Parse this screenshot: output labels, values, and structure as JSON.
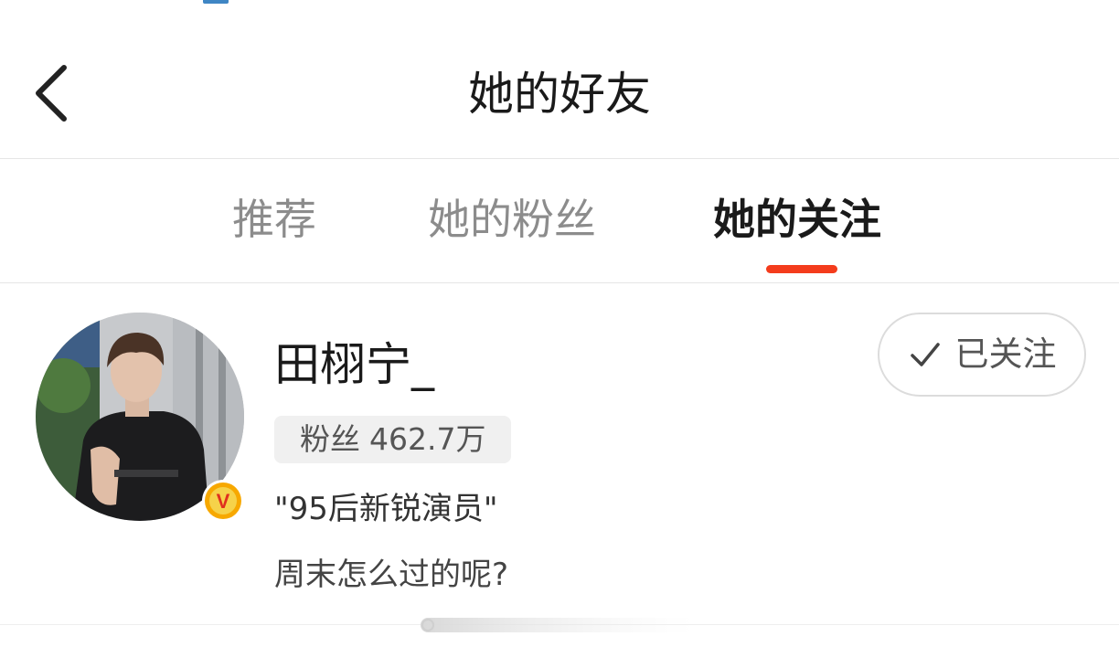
{
  "header": {
    "title": "她的好友",
    "back_icon": "chevron-left-icon"
  },
  "tabs": [
    {
      "label": "推荐",
      "active": false
    },
    {
      "label": "她的粉丝",
      "active": false
    },
    {
      "label": "她的关注",
      "active": true
    }
  ],
  "colors": {
    "accent": "#f43c1c",
    "verified_badge": "#f7a800",
    "text_primary": "#1a1a1a",
    "text_muted": "#8c8c8c"
  },
  "users": [
    {
      "name": "田栩宁_",
      "fans_label": "粉丝",
      "fans_count": "462.7万",
      "bio": "\"95后新锐演员\"",
      "recent_post": "周末怎么过的呢?",
      "follow_button": {
        "label": "已关注",
        "icon": "check-icon"
      },
      "verified_badge_letter": "V"
    }
  ]
}
